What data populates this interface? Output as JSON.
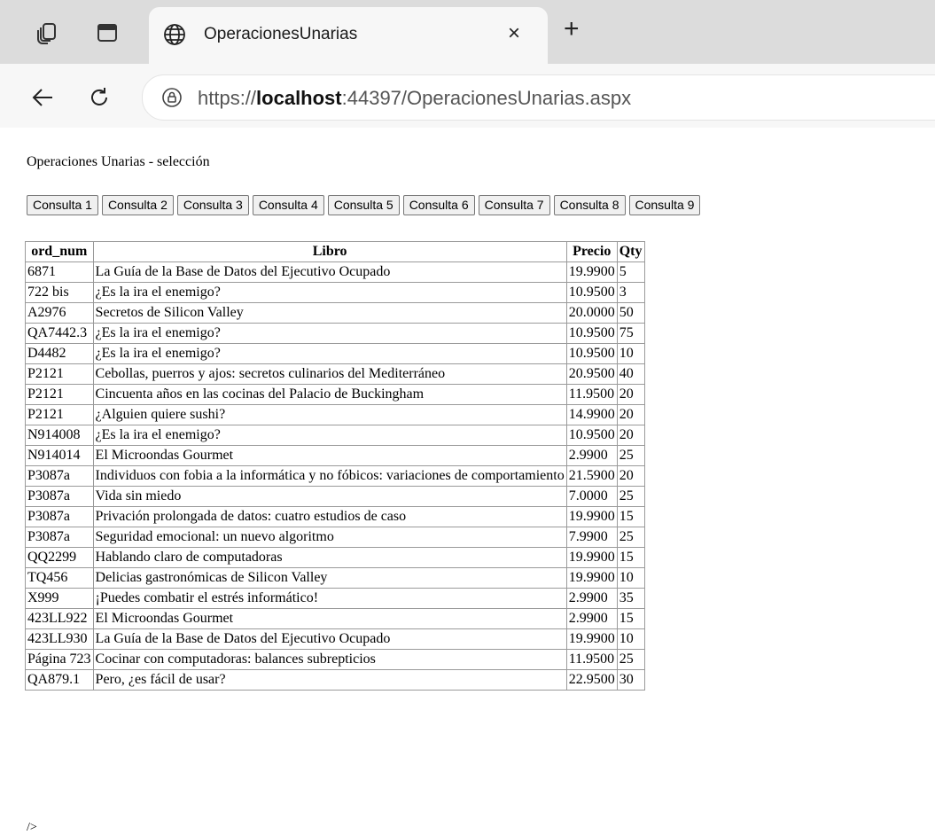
{
  "browser": {
    "tab_title": "OperacionesUnarias",
    "url_prefix": "https://",
    "url_host": "localhost",
    "url_rest": ":44397/OperacionesUnarias.aspx"
  },
  "page": {
    "heading": "Operaciones Unarias - selección",
    "buttons": [
      "Consulta 1",
      "Consulta 2",
      "Consulta 3",
      "Consulta 4",
      "Consulta 5",
      "Consulta 6",
      "Consulta 7",
      "Consulta 8",
      "Consulta 9"
    ],
    "tail": "/>"
  },
  "table": {
    "headers": [
      "ord_num",
      "Libro",
      "Precio",
      "Qty"
    ],
    "rows": [
      [
        "6871",
        "La Guía de la Base de Datos del Ejecutivo Ocupado",
        "19.9900",
        "5"
      ],
      [
        "722 bis",
        "¿Es la ira el enemigo?",
        "10.9500",
        "3"
      ],
      [
        "A2976",
        "Secretos de Silicon Valley",
        "20.0000",
        "50"
      ],
      [
        "QA7442.3",
        "¿Es la ira el enemigo?",
        "10.9500",
        "75"
      ],
      [
        "D4482",
        "¿Es la ira el enemigo?",
        "10.9500",
        "10"
      ],
      [
        "P2121",
        "Cebollas, puerros y ajos: secretos culinarios del Mediterráneo",
        "20.9500",
        "40"
      ],
      [
        "P2121",
        "Cincuenta años en las cocinas del Palacio de Buckingham",
        "11.9500",
        "20"
      ],
      [
        "P2121",
        "¿Alguien quiere sushi?",
        "14.9900",
        "20"
      ],
      [
        "N914008",
        "¿Es la ira el enemigo?",
        "10.9500",
        "20"
      ],
      [
        "N914014",
        "El Microondas Gourmet",
        "2.9900",
        "25"
      ],
      [
        "P3087a",
        "Individuos con fobia a la informática y no fóbicos: variaciones de comportamiento",
        "21.5900",
        "20"
      ],
      [
        "P3087a",
        "Vida sin miedo",
        "7.0000",
        "25"
      ],
      [
        "P3087a",
        "Privación prolongada de datos: cuatro estudios de caso",
        "19.9900",
        "15"
      ],
      [
        "P3087a",
        "Seguridad emocional: un nuevo algoritmo",
        "7.9900",
        "25"
      ],
      [
        "QQ2299",
        "Hablando claro de computadoras",
        "19.9900",
        "15"
      ],
      [
        "TQ456",
        "Delicias gastronómicas de Silicon Valley",
        "19.9900",
        "10"
      ],
      [
        "X999",
        "¡Puedes combatir el estrés informático!",
        "2.9900",
        "35"
      ],
      [
        "423LL922",
        "El Microondas Gourmet",
        "2.9900",
        "15"
      ],
      [
        "423LL930",
        "La Guía de la Base de Datos del Ejecutivo Ocupado",
        "19.9900",
        "10"
      ],
      [
        "Página 723",
        "Cocinar con computadoras: balances subrepticios",
        "11.9500",
        "25"
      ],
      [
        "QA879.1",
        "Pero, ¿es fácil de usar?",
        "22.9500",
        "30"
      ]
    ]
  },
  "icons": {
    "workspaces": "workspaces-icon",
    "tab_actions": "tab-actions-icon",
    "globe": "globe-icon",
    "close": "close-icon",
    "new_tab": "plus-icon",
    "back": "back-arrow-icon",
    "refresh": "refresh-icon",
    "lock": "lock-icon"
  },
  "glyphs": {
    "close": "×",
    "new_tab": "+"
  }
}
